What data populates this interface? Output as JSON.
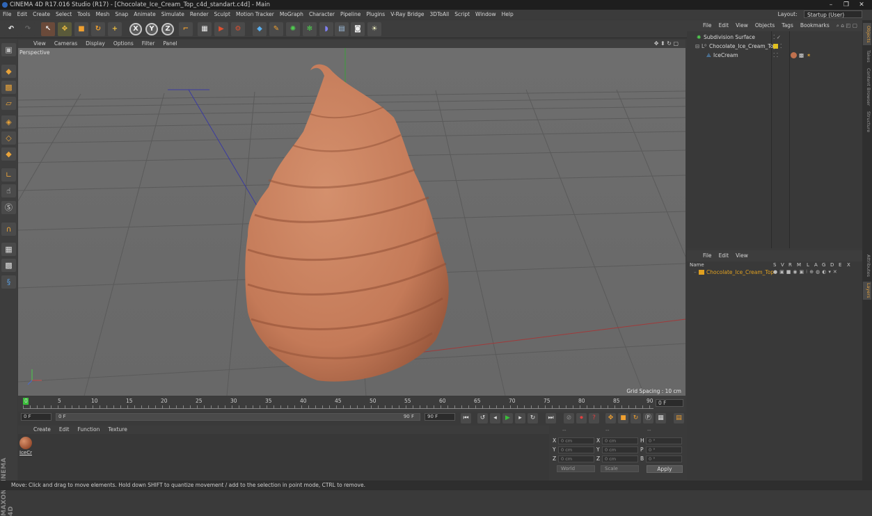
{
  "window": {
    "title": "CINEMA 4D R17.016 Studio (R17) - [Chocolate_Ice_Cream_Top_c4d_standart.c4d] - Main",
    "controls": [
      "–",
      "❐",
      "✕"
    ]
  },
  "menubar": {
    "items": [
      "File",
      "Edit",
      "Create",
      "Select",
      "Tools",
      "Mesh",
      "Snap",
      "Animate",
      "Simulate",
      "Render",
      "Sculpt",
      "Motion Tracker",
      "MoGraph",
      "Character",
      "Pipeline",
      "Plugins",
      "V-Ray Bridge",
      "3DToAll",
      "Script",
      "Window",
      "Help"
    ],
    "layout_label": "Layout:",
    "layout_value": "Startup (User)"
  },
  "toolbar": {
    "axis_x": "X",
    "axis_y": "Y",
    "axis_z": "Z"
  },
  "viewport": {
    "menu": [
      "View",
      "Cameras",
      "Display",
      "Options",
      "Filter",
      "Panel"
    ],
    "camera_label": "Perspective",
    "grid_spacing": "Grid Spacing : 10 cm",
    "model_color": "#c9805f",
    "background_color": "#6c6c6c"
  },
  "timeline": {
    "ticks": [
      "0",
      "5",
      "10",
      "15",
      "20",
      "25",
      "30",
      "35",
      "40",
      "45",
      "50",
      "55",
      "60",
      "65",
      "70",
      "75",
      "80",
      "85",
      "90"
    ],
    "end_frame": "0 F"
  },
  "transport": {
    "start_field": "0 F",
    "range_start": "0 F",
    "range_end": "90 F",
    "end_field": "90 F"
  },
  "material_manager": {
    "menu": [
      "Create",
      "Edit",
      "Function",
      "Texture"
    ],
    "material_name": "IceCr"
  },
  "coordinates": {
    "header": [
      "--",
      "--",
      "--"
    ],
    "rows": [
      {
        "axis": "X",
        "pos": "0 cm",
        "axis2": "X",
        "size": "0 cm",
        "rot_axis": "H",
        "rot": "0 °"
      },
      {
        "axis": "Y",
        "pos": "0 cm",
        "axis2": "Y",
        "size": "0 cm",
        "rot_axis": "P",
        "rot": "0 °"
      },
      {
        "axis": "Z",
        "pos": "0 cm",
        "axis2": "Z",
        "size": "0 cm",
        "rot_axis": "B",
        "rot": "0 °"
      }
    ],
    "mode_world": "World",
    "mode_scale": "Scale",
    "apply_label": "Apply"
  },
  "object_manager": {
    "menu": [
      "File",
      "Edit",
      "View",
      "Objects",
      "Tags",
      "Bookmarks"
    ],
    "objects": [
      {
        "name": "Subdivision Surface",
        "indent": 0
      },
      {
        "name": "Chocolate_Ice_Cream_Top",
        "indent": 1
      },
      {
        "name": "IceCream",
        "indent": 2
      }
    ]
  },
  "layer_manager": {
    "menu": [
      "File",
      "Edit",
      "View"
    ],
    "columns": [
      "Name",
      "S",
      "V",
      "R",
      "M",
      "L",
      "A",
      "G",
      "D",
      "E",
      "X"
    ],
    "layer_name": "Chocolate_Ice_Cream_Top",
    "layer_color": "#e0a020"
  },
  "side_tabs": [
    "Objects",
    "Takes",
    "Content Browser",
    "Structure",
    "Attributes",
    "Layers"
  ],
  "maxon_logo": "MAXON CINEMA 4D",
  "status": "Move: Click and drag to move elements. Hold down SHIFT to quantize movement / add to the selection in point mode, CTRL to remove."
}
